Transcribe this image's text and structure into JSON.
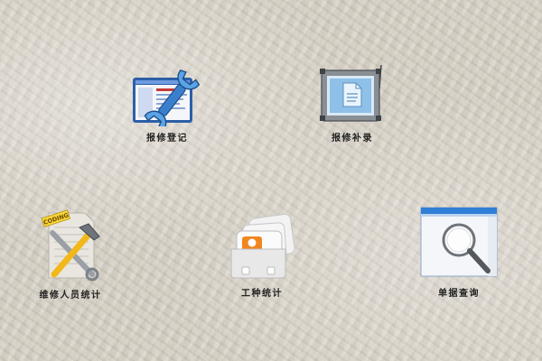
{
  "tiles": [
    {
      "id": "register",
      "label": "报修登记",
      "icon": "browser-wrench-icon"
    },
    {
      "id": "record",
      "label": "报修补录",
      "icon": "document-monitor-icon"
    },
    {
      "id": "staff",
      "label": "维修人员统计",
      "icon": "hammer-wrench-icon"
    },
    {
      "id": "type",
      "label": "工种统计",
      "icon": "contact-cards-icon"
    },
    {
      "id": "query",
      "label": "单据查询",
      "icon": "magnifier-window-icon"
    }
  ],
  "badge_text": "CODING",
  "colors": {
    "label_text": "#222222",
    "browser_frame": "#2c5fa8",
    "wrench": "#5aa3e6",
    "hammer_handle": "#f2b81a",
    "contact_orange": "#f0861f",
    "query_title_bar": "#2f7fd6"
  }
}
